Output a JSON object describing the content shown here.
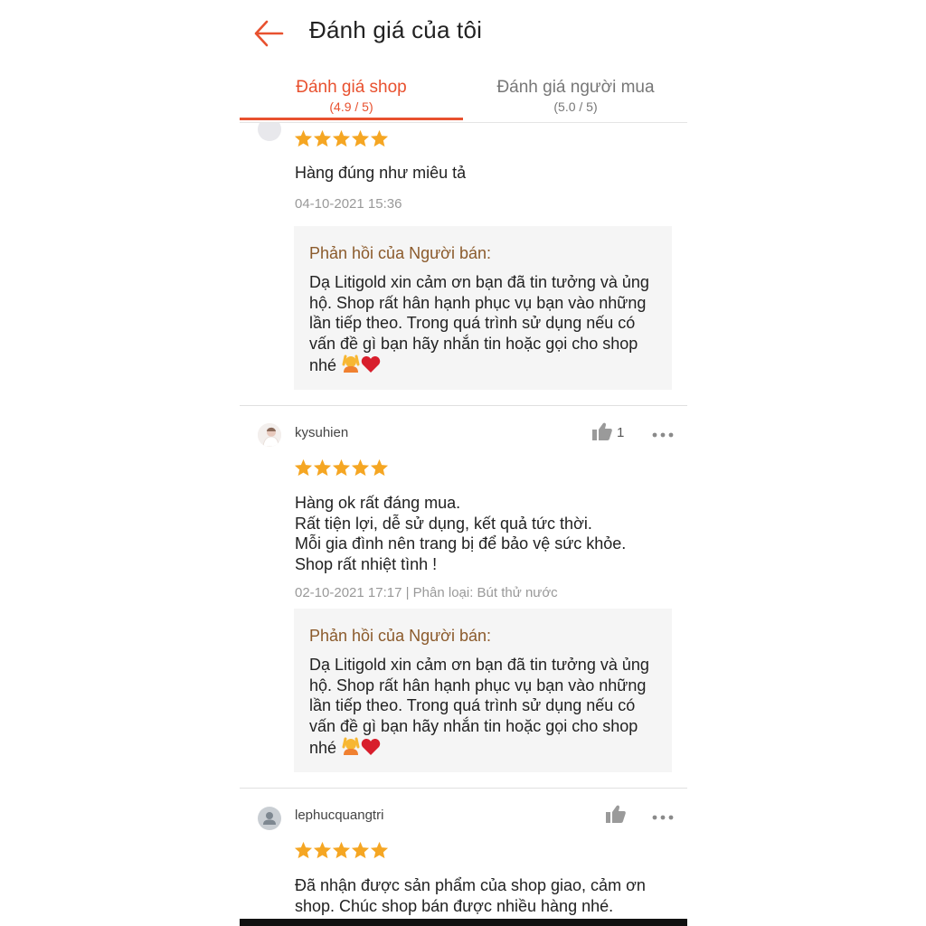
{
  "header": {
    "title": "Đánh giá của tôi"
  },
  "tabs": [
    {
      "label": "Đánh giá shop",
      "score": "(4.9 / 5)",
      "active": true
    },
    {
      "label": "Đánh giá người mua",
      "score": "(5.0 / 5)",
      "active": false
    }
  ],
  "colors": {
    "accent": "#e8512f",
    "star": "#f5a623",
    "reply_title": "#8b5a2b",
    "reply_bg": "#f5f5f5"
  },
  "reviews": [
    {
      "rating": 5,
      "content": "Hàng đúng như miêu tả",
      "meta": "04-10-2021 15:36",
      "reply_title": "Phản hồi của Người bán:",
      "reply_text": "Dạ Litigold xin cảm ơn bạn đã tin tưởng và ủng hộ. Shop rất hân hạnh phục vụ bạn vào những lần tiếp theo. Trong quá trình sử dụng nếu có vấn đề gì bạn hãy nhắn tin hoặc gọi cho shop nhé"
    },
    {
      "username": "kysuhien",
      "likes": "1",
      "rating": 5,
      "content_lines": [
        "Hàng ok rất đáng mua.",
        "Rất tiện lợi, dễ sử dụng, kết quả tức thời.",
        "Mỗi gia đình nên trang bị để bảo vệ sức khỏe.",
        "Shop rất nhiệt tình !"
      ],
      "meta": "02-10-2021 17:17 | Phân loại: Bút thử nước",
      "reply_title": "Phản hồi của Người bán:",
      "reply_text": "Dạ Litigold xin cảm ơn bạn đã tin tưởng và ủng hộ. Shop rất hân hạnh phục vụ bạn vào những lần tiếp theo. Trong quá trình sử dụng nếu có vấn đề gì bạn hãy nhắn tin hoặc gọi cho shop nhé"
    },
    {
      "username": "lephucquangtri",
      "rating": 5,
      "content": "Đã nhận được sản phẩm của shop giao, cảm ơn shop. Chúc shop bán được nhiều hàng nhé."
    }
  ],
  "icons": {
    "back": "arrow-left-icon",
    "like": "thumb-up-icon",
    "more": "more-horizontal-icon",
    "star": "star-icon",
    "avatar": "user-avatar-icon"
  }
}
